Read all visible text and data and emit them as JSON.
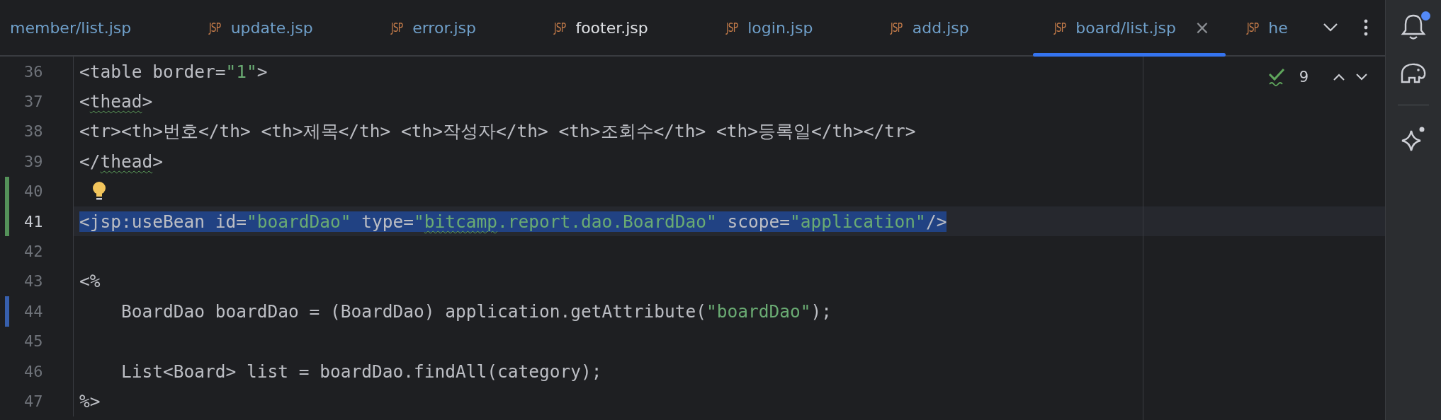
{
  "tabs": [
    {
      "label": "member/list.jsp",
      "selected": false,
      "vcs_modified": true
    },
    {
      "icon": "JSP",
      "label": "update.jsp",
      "selected": false,
      "vcs_modified": true
    },
    {
      "icon": "JSP",
      "label": "error.jsp",
      "selected": false,
      "vcs_modified": true
    },
    {
      "icon": "JSP",
      "label": "footer.jsp",
      "selected": false,
      "vcs_modified": false
    },
    {
      "icon": "JSP",
      "label": "login.jsp",
      "selected": false,
      "vcs_modified": true
    },
    {
      "icon": "JSP",
      "label": "add.jsp",
      "selected": false,
      "vcs_modified": true
    },
    {
      "icon": "JSP",
      "label": "board/list.jsp",
      "selected": true,
      "vcs_modified": true,
      "close": "×"
    },
    {
      "icon": "JSP",
      "label": "he",
      "selected": false,
      "vcs_modified": true
    }
  ],
  "inspections": {
    "count": "9"
  },
  "notifications": {
    "unread": true
  },
  "lines": [
    {
      "number": "36",
      "selected": false,
      "tokens": [
        {
          "kind": "plain",
          "text": "<table border="
        },
        {
          "kind": "string",
          "text": "\"1\""
        },
        {
          "kind": "plain",
          "text": ">"
        }
      ]
    },
    {
      "number": "37",
      "selected": false,
      "tokens": [
        {
          "kind": "plain",
          "text": "<"
        },
        {
          "kind": "typo",
          "text": "thead"
        },
        {
          "kind": "plain",
          "text": ">"
        }
      ]
    },
    {
      "number": "38",
      "selected": false,
      "tokens": [
        {
          "kind": "plain",
          "text": "<tr><th>번호</th> <th>제목</th> <th>작성자</th> <th>조회수</th> <th>등록일</th></tr>"
        }
      ]
    },
    {
      "number": "39",
      "selected": false,
      "tokens": [
        {
          "kind": "plain",
          "text": "</"
        },
        {
          "kind": "typo",
          "text": "thead"
        },
        {
          "kind": "plain",
          "text": ">"
        }
      ]
    },
    {
      "number": "40",
      "selected": false,
      "bulb": true,
      "color": "#549159"
    },
    {
      "number": "41",
      "selected": true,
      "color": "#549159",
      "tokens": [
        {
          "kind": "plain",
          "text": "<jsp:useBean id="
        },
        {
          "kind": "string",
          "text": "\"boardDao\""
        },
        {
          "kind": "plain",
          "text": " type="
        },
        {
          "kind": "string",
          "text": "\""
        },
        {
          "kind": "string-typo",
          "text": "bitcamp"
        },
        {
          "kind": "string",
          "text": ".report.dao.BoardDao\""
        },
        {
          "kind": "plain",
          "text": " scope="
        },
        {
          "kind": "string",
          "text": "\"application\""
        },
        {
          "kind": "plain",
          "text": "/>"
        }
      ]
    },
    {
      "number": "42",
      "selected": false
    },
    {
      "number": "43",
      "selected": false,
      "tokens": [
        {
          "kind": "plain",
          "text": "<%"
        }
      ]
    },
    {
      "number": "44",
      "selected": false,
      "color": "#375fad",
      "tokens": [
        {
          "kind": "plain",
          "text": "    BoardDao boardDao = (BoardDao) application.getAttribute("
        },
        {
          "kind": "string",
          "text": "\"boardDao\""
        },
        {
          "kind": "plain",
          "text": ");"
        }
      ]
    },
    {
      "number": "45",
      "selected": false
    },
    {
      "number": "46",
      "selected": false,
      "tokens": [
        {
          "kind": "plain",
          "text": "    List<Board> list = boardDao.findAll(category);"
        }
      ]
    },
    {
      "number": "47",
      "selected": false,
      "tokens": [
        {
          "kind": "plain",
          "text": "%>"
        }
      ]
    }
  ]
}
